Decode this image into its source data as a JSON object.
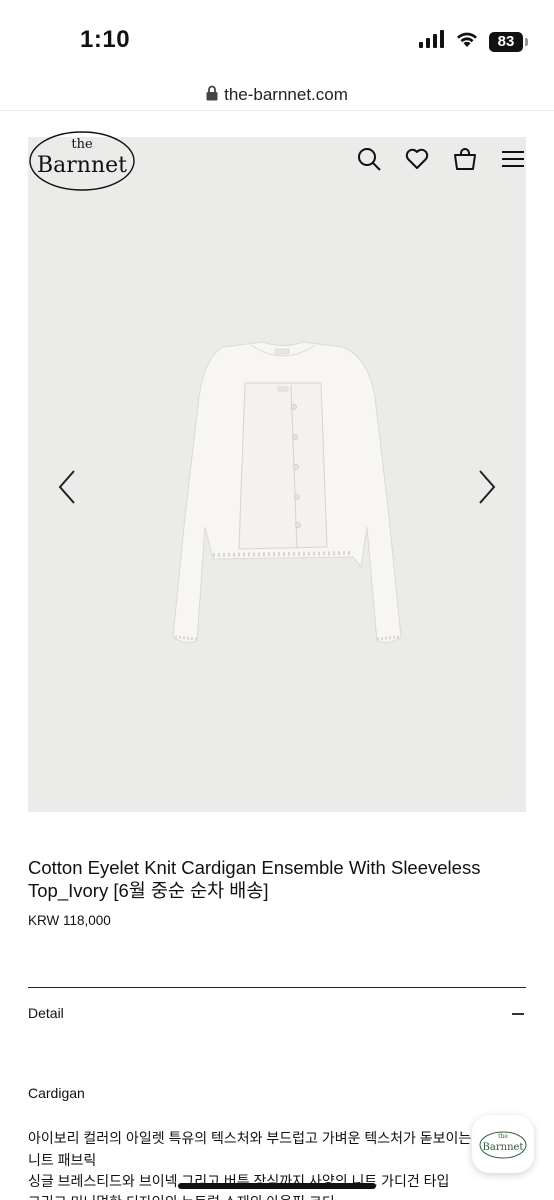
{
  "status_bar": {
    "time": "1:10",
    "battery": "83",
    "icons": [
      "signal-icon",
      "wifi-icon",
      "battery-icon"
    ]
  },
  "browser": {
    "url": "the-barnnet.com",
    "lock_icon": "lock-icon"
  },
  "header": {
    "logo_top": "the",
    "logo_main": "Barnnet",
    "icons": [
      "search-icon",
      "heart-icon",
      "shopping-bag-icon",
      "menu-icon"
    ]
  },
  "gallery": {
    "prev_icon": "chevron-left-icon",
    "next_icon": "chevron-right-icon",
    "background": "#ebebe9"
  },
  "product": {
    "title_line1": "Cotton Eyelet Knit Cardigan Ensemble With Sleeveless",
    "title_line2": "Top_Ivory [6월 중순 순차 배송]",
    "price": "KRW 118,000"
  },
  "detail": {
    "label": "Detail",
    "toggle_icon": "minus-icon",
    "heading": "Cardigan",
    "lines": [
      "아이보리 컬러의 아일렛 특유의 텍스처와 부드럽고 가벼운 텍스처가 돋보이는",
      "니트 패브릭",
      "싱글 브레스티드와 브이넥 그리고 버튼 장식까지 사양의 니트 가디건 타입",
      "그리고 미니멀한 디자인의 뉴트럴 소재의 아웃핏 코디"
    ]
  },
  "chat": {
    "logo_top": "the",
    "logo_main": "Barnnet"
  }
}
